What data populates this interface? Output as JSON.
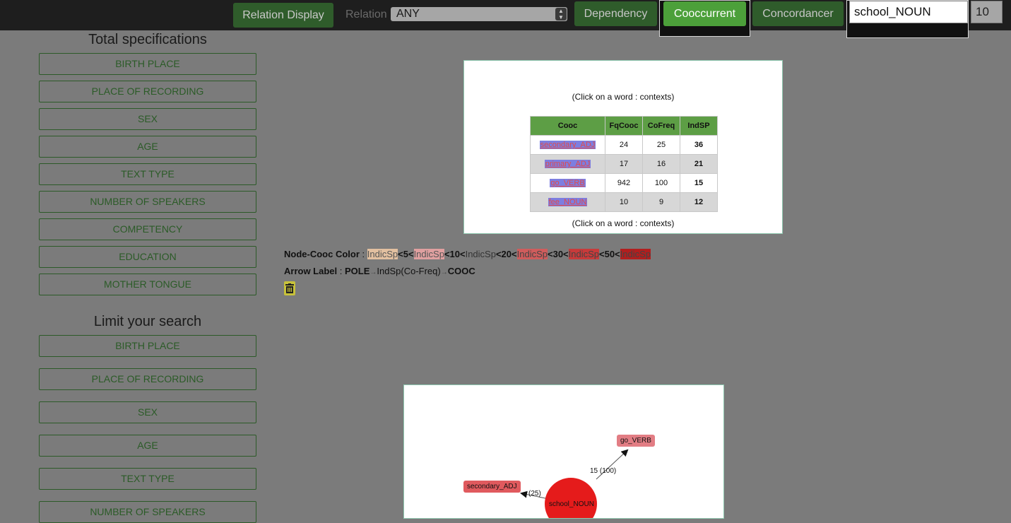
{
  "topbar": {
    "relation_display_label": "Relation Display",
    "relation_label": "Relation",
    "relation_value": "ANY",
    "dependency_label": "Dependency",
    "cooccurrent_label": "Cooccurrent",
    "concordancer_label": "Concordancer",
    "search_value": "school_NOUN",
    "count_value": "10"
  },
  "sidebar": {
    "total_heading": "Total specifications",
    "total_items": [
      "BIRTH PLACE",
      "PLACE OF RECORDING",
      "SEX",
      "AGE",
      "TEXT TYPE",
      "NUMBER OF SPEAKERS",
      "COMPETENCY",
      "EDUCATION",
      "MOTHER TONGUE"
    ],
    "limit_heading": "Limit your search",
    "limit_items": [
      "BIRTH PLACE",
      "PLACE OF RECORDING",
      "SEX",
      "AGE",
      "TEXT TYPE",
      "NUMBER OF SPEAKERS"
    ]
  },
  "table_panel": {
    "note_top": "(Click on a word : contexts)",
    "note_bottom": "(Click on a word : contexts)",
    "columns": [
      "Cooc",
      "FqCooc",
      "CoFreq",
      "IndSP"
    ],
    "rows": [
      {
        "word": "secondary_ADJ",
        "fqcooc": "24",
        "cofreq": "25",
        "indsp": "36"
      },
      {
        "word": "primary_ADJ",
        "fqcooc": "17",
        "cofreq": "16",
        "indsp": "21"
      },
      {
        "word": "go_VERB",
        "fqcooc": "942",
        "cofreq": "100",
        "indsp": "15"
      },
      {
        "word": "fee_NOUN",
        "fqcooc": "10",
        "cofreq": "9",
        "indsp": "12"
      }
    ]
  },
  "legend": {
    "color_title": "Node-Cooc Color",
    "sep": ":",
    "indic": "IndicSp",
    "t5": "<5<",
    "t10": "<10<",
    "t20": "<20<",
    "t30": "<30<",
    "t50": "<50<",
    "arrow_title": "Arrow Label",
    "pole": "POLE",
    "arrow_mid": "IndSp(Co-Freq)",
    "cooc": "COOC"
  },
  "graph": {
    "nodes": {
      "center": "school_NOUN",
      "go": "go_VERB",
      "secondary": "secondary_ADJ"
    },
    "edges": {
      "go": "15 (100)",
      "secondary": "(25)"
    },
    "colors": {
      "center": "#e51b1b",
      "go": "#e27d84",
      "secondary": "#e05a5e"
    }
  },
  "colors": {
    "topbar_bg": "#1e1e1e",
    "page_bg": "#7b7b7b",
    "button_green": "#2f5c2b",
    "active_green": "#4ca03a",
    "table_header": "#5d9e45"
  }
}
